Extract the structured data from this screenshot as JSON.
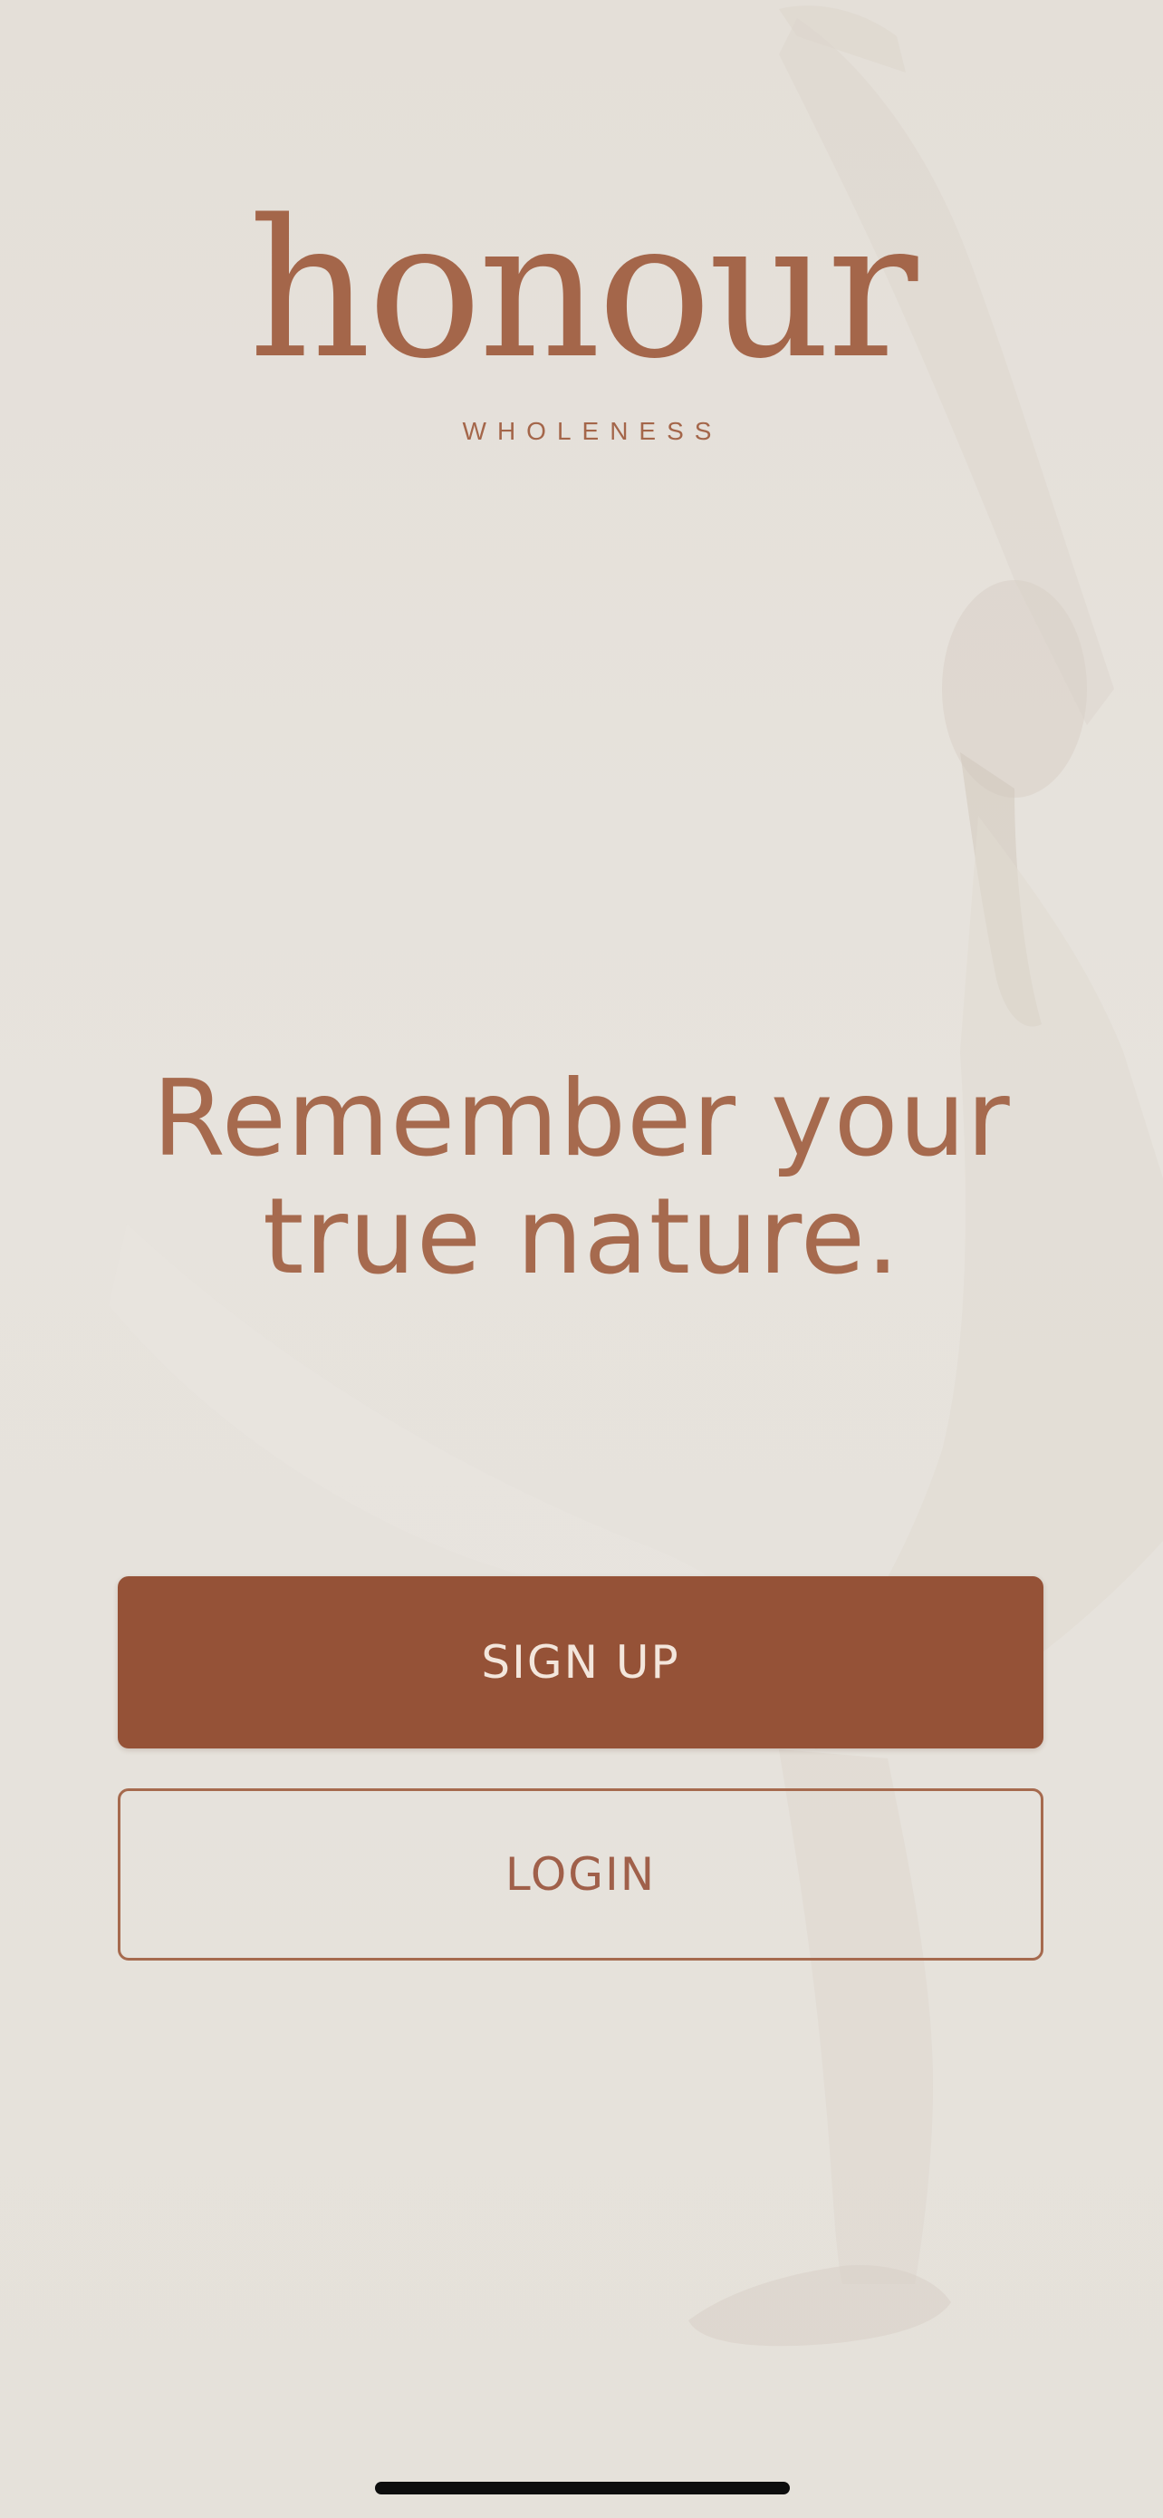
{
  "brand": {
    "wordmark": "honour",
    "subtitle": "WHOLENESS",
    "color": "#a4664a"
  },
  "hero": {
    "line1": "Remember your",
    "line2": "true nature."
  },
  "actions": {
    "signup_label": "SIGN UP",
    "login_label": "LOGIN"
  },
  "colors": {
    "background": "#e6e2dc",
    "primary_button": "#955237",
    "primary_button_text": "#f3e6dc",
    "accent": "#a66a4e"
  }
}
